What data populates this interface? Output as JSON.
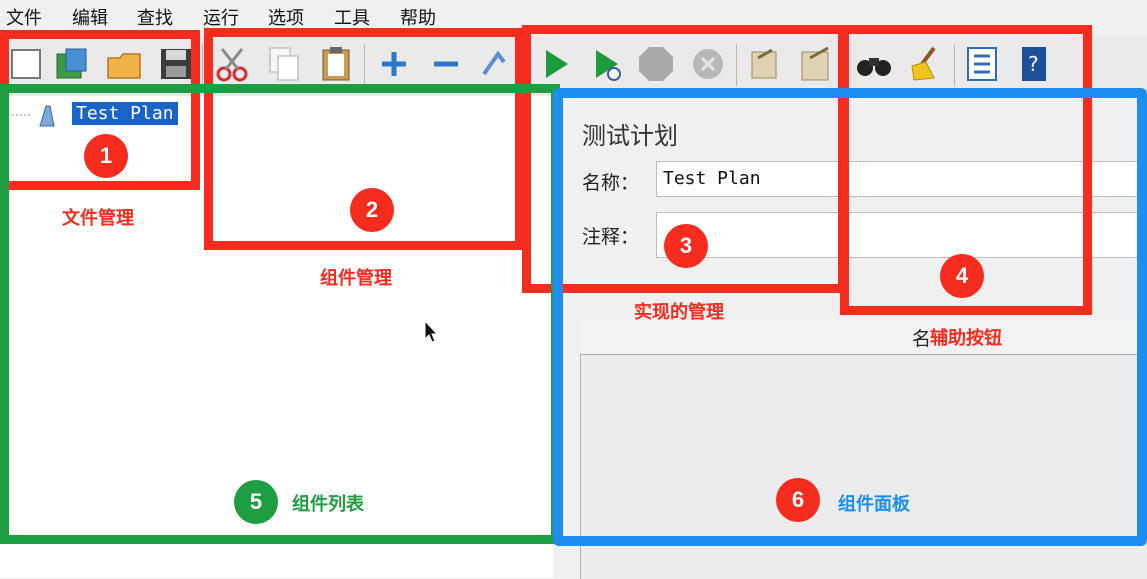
{
  "menu": [
    "文件",
    "编辑",
    "查找",
    "运行",
    "选项",
    "工具",
    "帮助"
  ],
  "toolbar": {
    "icons": [
      "new-icon",
      "templates-icon",
      "open-icon",
      "save-icon",
      "cut-icon",
      "copy-icon",
      "paste-icon",
      "expand-icon",
      "collapse-icon",
      "toggle-icon",
      "start-icon",
      "start-no-pause-icon",
      "stop-icon",
      "shutdown-icon",
      "clear-icon",
      "clear-all-icon",
      "search-icon",
      "reset-search-icon",
      "function-helper-icon",
      "help-icon"
    ]
  },
  "tree": {
    "root_label": "Test Plan"
  },
  "panel": {
    "title": "测试计划",
    "name_label": "名称：",
    "name_value": "Test Plan",
    "comment_label": "注释：",
    "comment_value": "",
    "table_header_partial": "名"
  },
  "annotations": {
    "labels": [
      "文件管理",
      "组件管理",
      "实现的管理",
      "辅助按钮",
      "组件列表",
      "组件面板"
    ],
    "numbers": [
      "1",
      "2",
      "3",
      "4",
      "5",
      "6"
    ],
    "colors": {
      "red": "#f52c1e",
      "green": "#1f9d43",
      "blue": "#1c8ef0"
    }
  }
}
